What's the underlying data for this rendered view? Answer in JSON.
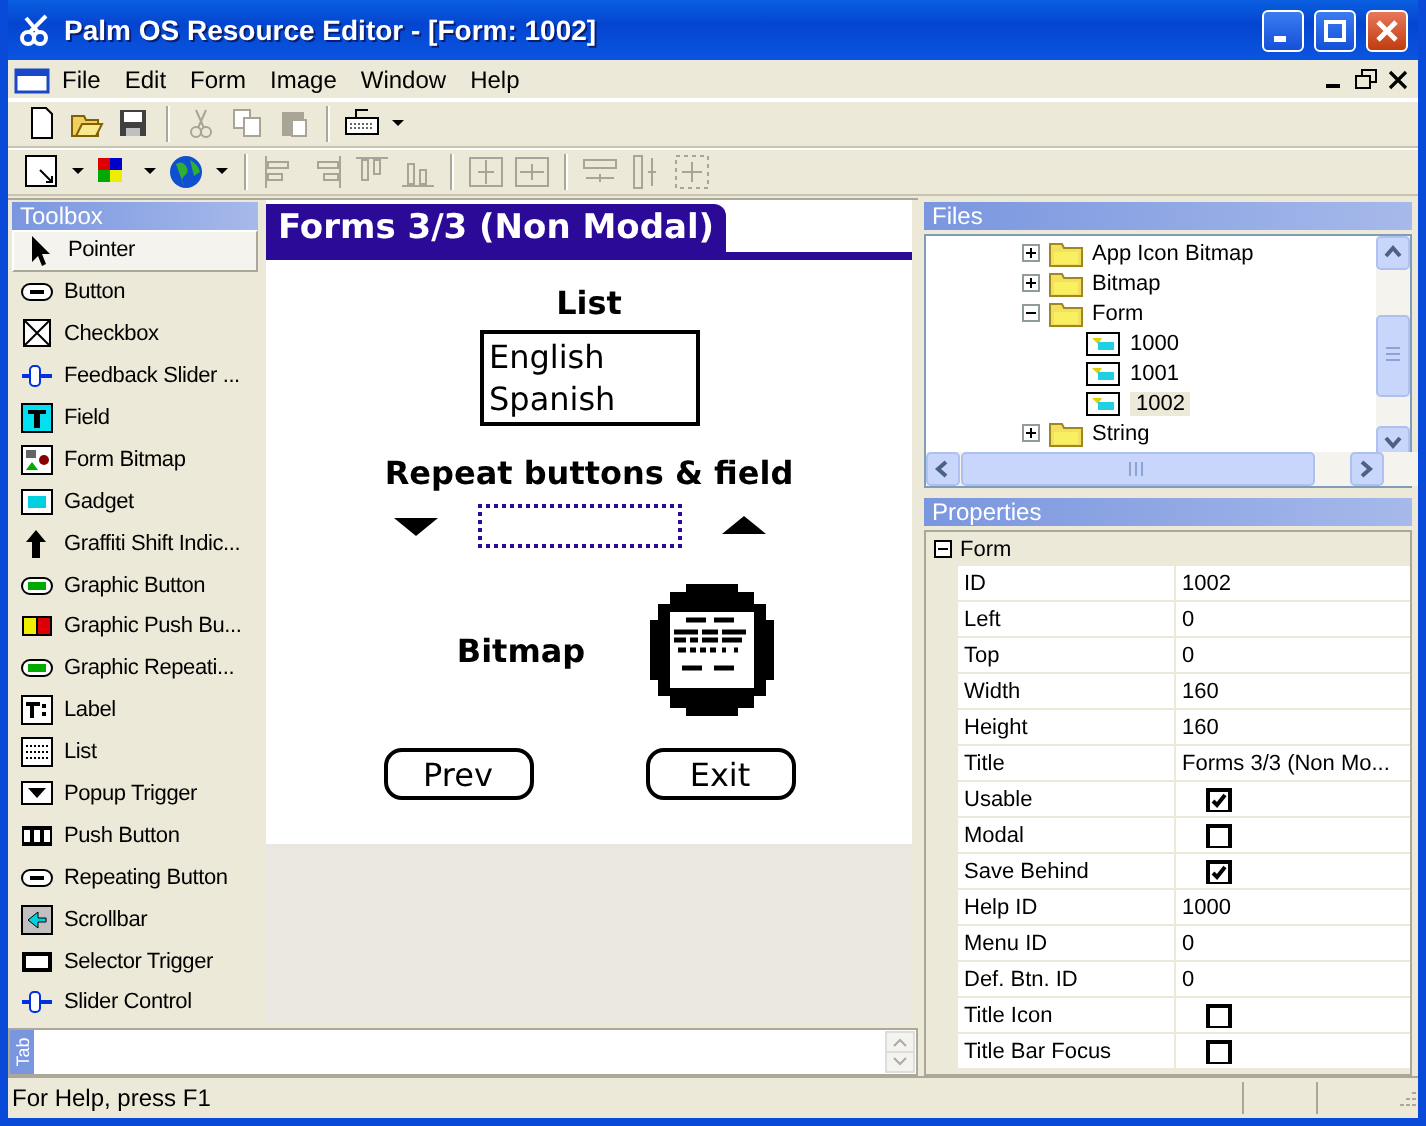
{
  "window": {
    "title": "Palm OS Resource Editor - [Form: 1002]"
  },
  "menu": [
    "File",
    "Edit",
    "Form",
    "Image",
    "Window",
    "Help"
  ],
  "toolbox": {
    "title": "Toolbox",
    "items": [
      {
        "label": "Pointer",
        "kind": "pointer",
        "selected": true
      },
      {
        "label": "Button",
        "kind": "button",
        "selected": false
      },
      {
        "label": "Checkbox",
        "kind": "checkbox",
        "selected": false
      },
      {
        "label": "Feedback Slider ...",
        "kind": "slider",
        "selected": false
      },
      {
        "label": "Field",
        "kind": "field",
        "selected": false
      },
      {
        "label": "Form Bitmap",
        "kind": "bitmap",
        "selected": false
      },
      {
        "label": "Gadget",
        "kind": "gadget",
        "selected": false
      },
      {
        "label": "Graffiti Shift Indic...",
        "kind": "shift",
        "selected": false
      },
      {
        "label": "Graphic Button",
        "kind": "gbutton",
        "selected": false
      },
      {
        "label": "Graphic Push Bu...",
        "kind": "gpush",
        "selected": false
      },
      {
        "label": "Graphic Repeati...",
        "kind": "gbutton",
        "selected": false
      },
      {
        "label": "Label",
        "kind": "label",
        "selected": false
      },
      {
        "label": "List",
        "kind": "list",
        "selected": false
      },
      {
        "label": "Popup Trigger",
        "kind": "popup",
        "selected": false
      },
      {
        "label": "Push Button",
        "kind": "push",
        "selected": false
      },
      {
        "label": "Repeating Button",
        "kind": "button",
        "selected": false
      },
      {
        "label": "Scrollbar",
        "kind": "scrollbar",
        "selected": false
      },
      {
        "label": "Selector Trigger",
        "kind": "selector",
        "selected": false
      },
      {
        "label": "Slider Control",
        "kind": "slider",
        "selected": false
      }
    ]
  },
  "form": {
    "title": "Forms 3/3 (Non Modal)",
    "list_label": "List",
    "list_items": [
      "English",
      "Spanish"
    ],
    "repeat_label": "Repeat buttons & field",
    "bitmap_label": "Bitmap",
    "buttons": [
      "Prev",
      "Exit"
    ]
  },
  "files": {
    "title": "Files",
    "tree": [
      {
        "label": "App Icon Bitmap",
        "expanded": false,
        "selected": false
      },
      {
        "label": "Bitmap",
        "expanded": false,
        "selected": false
      },
      {
        "label": "Form",
        "expanded": true,
        "selected": false,
        "children": [
          {
            "label": "1000",
            "selected": false
          },
          {
            "label": "1001",
            "selected": false
          },
          {
            "label": "1002",
            "selected": true
          }
        ]
      },
      {
        "label": "String",
        "expanded": false,
        "selected": false
      }
    ]
  },
  "properties": {
    "title": "Properties",
    "group": "Form",
    "expanded": true,
    "rows": [
      {
        "name": "ID",
        "kind": "text",
        "value": "1002"
      },
      {
        "name": "Left",
        "kind": "text",
        "value": "0"
      },
      {
        "name": "Top",
        "kind": "text",
        "value": "0"
      },
      {
        "name": "Width",
        "kind": "text",
        "value": "160"
      },
      {
        "name": "Height",
        "kind": "text",
        "value": "160"
      },
      {
        "name": "Title",
        "kind": "text",
        "value": "Forms 3/3 (Non Mo..."
      },
      {
        "name": "Usable",
        "kind": "check",
        "checked": true
      },
      {
        "name": "Modal",
        "kind": "check",
        "checked": false
      },
      {
        "name": "Save Behind",
        "kind": "check",
        "checked": true
      },
      {
        "name": "Help ID",
        "kind": "text",
        "value": "1000"
      },
      {
        "name": "Menu ID",
        "kind": "text",
        "value": "0"
      },
      {
        "name": "Def. Btn. ID",
        "kind": "text",
        "value": "0"
      },
      {
        "name": "Title Icon",
        "kind": "check",
        "checked": false
      },
      {
        "name": "Title Bar Focus",
        "kind": "check",
        "checked": false
      }
    ]
  },
  "tab_strip": {
    "label": "Tab"
  },
  "status_bar": "For Help, press F1"
}
